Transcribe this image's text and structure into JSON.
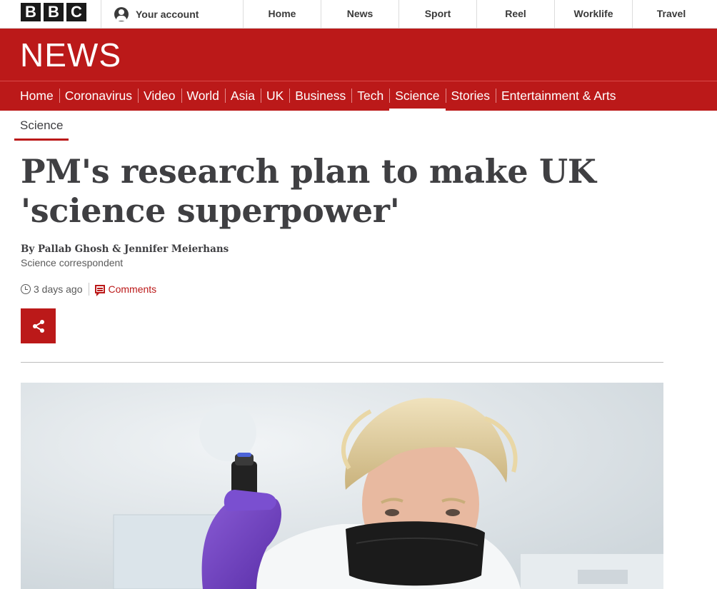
{
  "header": {
    "logo_letters": [
      "B",
      "B",
      "C"
    ],
    "account_label": "Your account",
    "account_icon": "user-circle-icon",
    "nav": [
      {
        "label": "Home"
      },
      {
        "label": "News"
      },
      {
        "label": "Sport"
      },
      {
        "label": "Reel"
      },
      {
        "label": "Worklife"
      },
      {
        "label": "Travel"
      }
    ]
  },
  "banner": {
    "wordmark": "NEWS",
    "color": "#bb1919"
  },
  "section_nav": {
    "items": [
      {
        "label": "Home"
      },
      {
        "label": "Coronavirus"
      },
      {
        "label": "Video"
      },
      {
        "label": "World"
      },
      {
        "label": "Asia"
      },
      {
        "label": "UK"
      },
      {
        "label": "Business"
      },
      {
        "label": "Tech"
      },
      {
        "label": "Science",
        "active": true
      },
      {
        "label": "Stories"
      },
      {
        "label": "Entertainment & Arts"
      }
    ]
  },
  "subsection": {
    "label": "Science"
  },
  "article": {
    "headline_line1": "PM's research plan to make UK",
    "headline_line2": "'science superpower'",
    "byline": "By Pallab Ghosh & Jennifer Meierhans",
    "byline_role": "Science correspondent",
    "timestamp": "3 days ago",
    "comments_label": "Comments",
    "share_icon": "share-icon",
    "hero_image_alt": "Man in face mask and lab coat holding a pipette with purple gloved hand"
  },
  "colors": {
    "brand_red": "#bb1919",
    "text": "#3f3f42",
    "logo_block": "#1a1a1a"
  }
}
